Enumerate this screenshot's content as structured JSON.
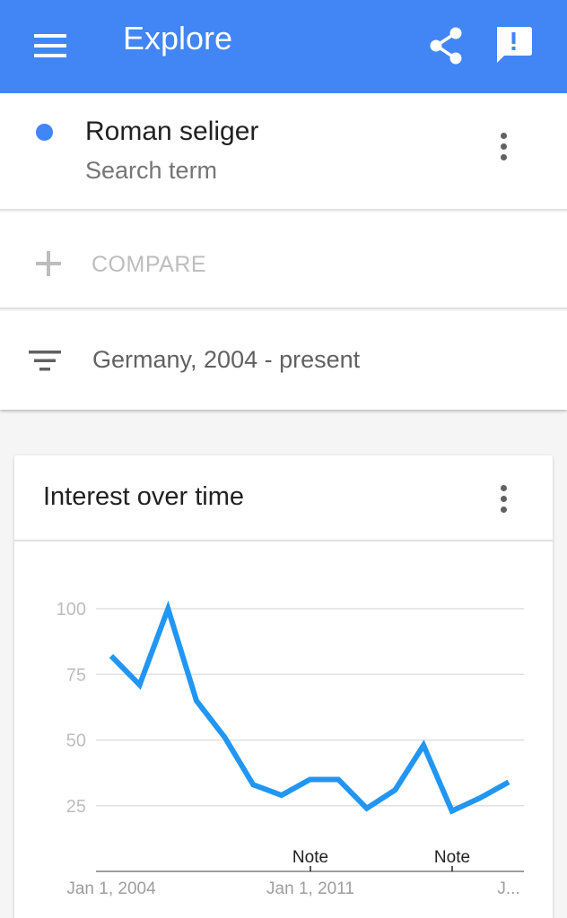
{
  "appbar": {
    "title": "Explore",
    "menu_icon": "hamburger-menu-icon",
    "share_icon": "share-icon",
    "feedback_icon": "feedback-icon"
  },
  "search_term": {
    "name": "Roman seliger",
    "type": "Search term",
    "color": "#4285f4"
  },
  "compare": {
    "label": "COMPARE"
  },
  "filter": {
    "label": "Germany, 2004 - present"
  },
  "interest_card": {
    "title": "Interest over time"
  },
  "chart_data": {
    "type": "line",
    "title": "Interest over time",
    "ylim": [
      0,
      100
    ],
    "yticks": [
      25,
      50,
      75,
      100
    ],
    "grid": true,
    "x_tick_labels": [
      "Jan 1, 2004",
      "Jan 1, 2011",
      "J..."
    ],
    "annotations": [
      {
        "label": "Note",
        "after_point": 7
      },
      {
        "label": "Note",
        "after_point": 12
      }
    ],
    "series": [
      {
        "color": "#2196f3",
        "values": [
          82,
          71,
          100,
          65,
          51,
          33,
          29,
          35,
          35,
          24,
          31,
          48,
          23,
          28,
          34
        ]
      }
    ]
  }
}
